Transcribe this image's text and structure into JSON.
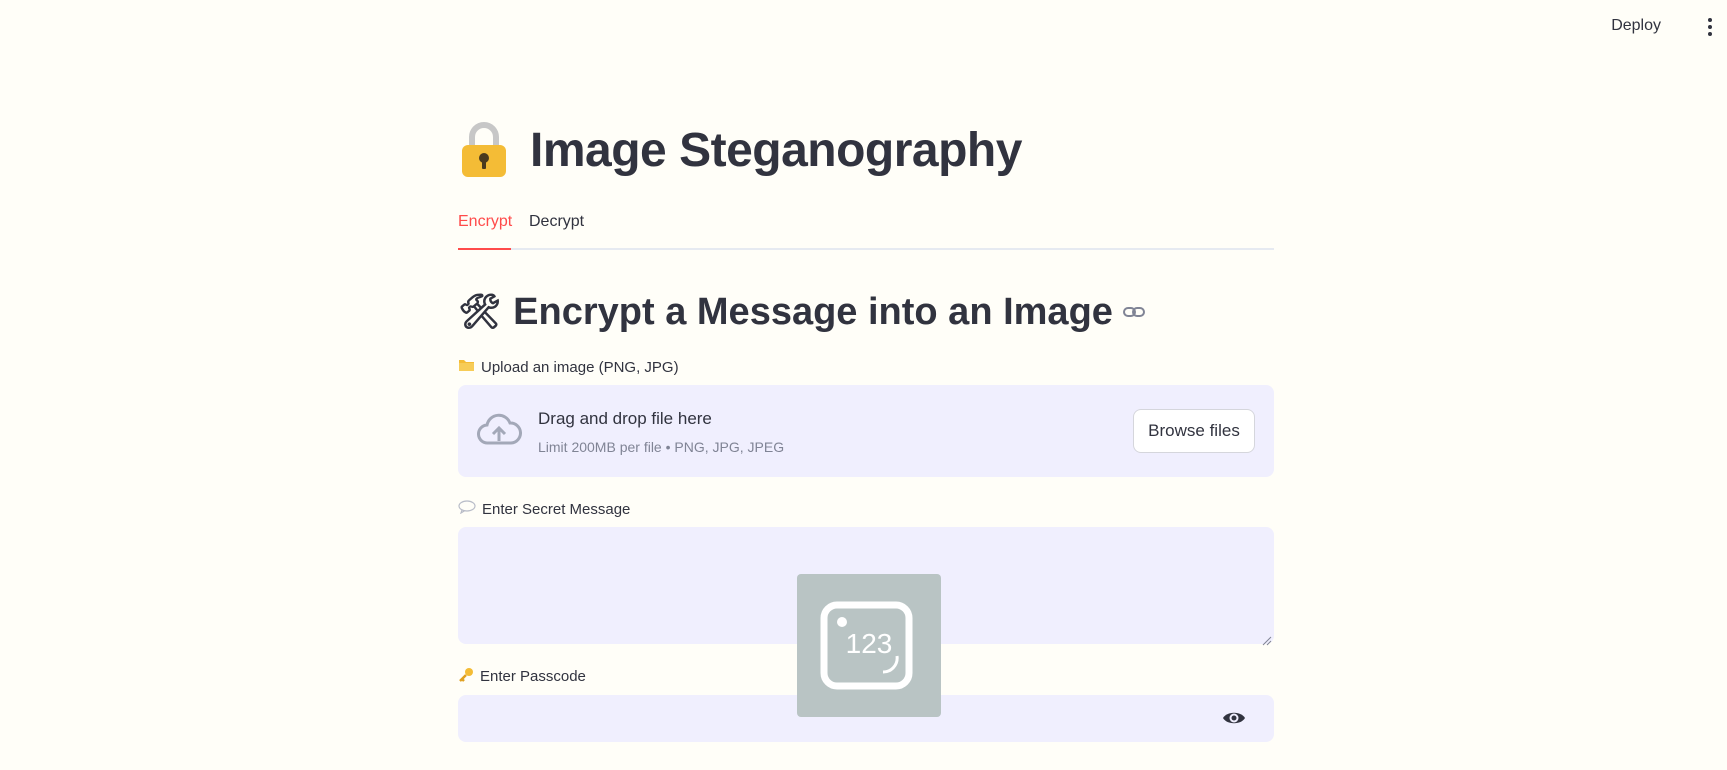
{
  "header": {
    "deploy_label": "Deploy",
    "menu_icon": "kebab-menu-icon"
  },
  "page": {
    "title_icon": "lock-icon",
    "title": "Image Steganography"
  },
  "tabs": [
    {
      "label": "Encrypt",
      "active": true
    },
    {
      "label": "Decrypt",
      "active": false
    }
  ],
  "section": {
    "icon": "hammer-wrench-icon",
    "heading": "Encrypt a Message into an Image",
    "anchor_icon": "link-icon"
  },
  "upload": {
    "label_icon": "folder-icon",
    "label": "Upload an image (PNG, JPG)",
    "drop_text": "Drag and drop file here",
    "limit_text": "Limit 200MB per file • PNG, JPG, JPEG",
    "browse_label": "Browse files"
  },
  "message": {
    "label_icon": "speech-bubble-icon",
    "label": "Enter Secret Message",
    "value": ""
  },
  "passcode": {
    "label_icon": "key-icon",
    "label": "Enter Passcode",
    "value": ""
  },
  "overlay": {
    "icon": "numeric-keypad-icon",
    "text": "123"
  },
  "colors": {
    "accent": "#ff4b4b",
    "background": "#fffef8",
    "input_bg": "#f0effe",
    "text": "#31333f"
  }
}
